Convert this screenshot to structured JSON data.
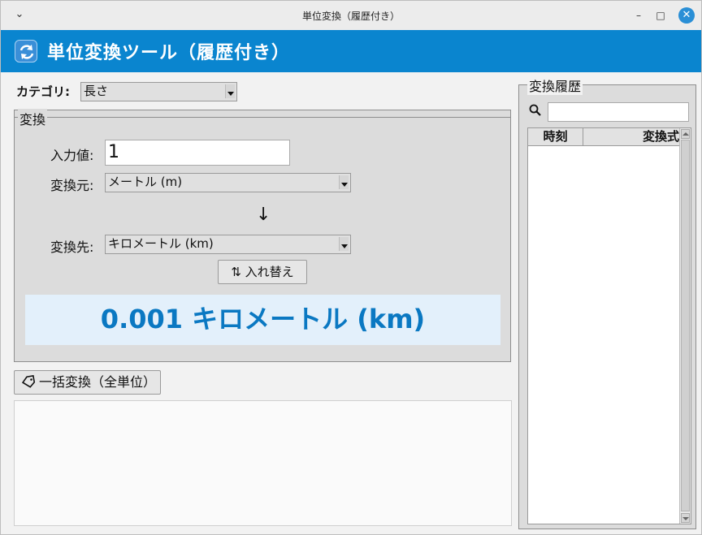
{
  "window": {
    "title": "単位変換（履歴付き）",
    "controls": {
      "menu": "⌄",
      "minimize": "–",
      "maximize": "□",
      "close": "✕"
    }
  },
  "header": {
    "title": "単位変換ツール（履歴付き）",
    "color": "#0a85cf"
  },
  "category": {
    "label": "カテゴリ:",
    "selected": "長さ"
  },
  "conversion": {
    "legend": "変換",
    "input_label": "入力値:",
    "input_value": "1",
    "from_label": "変換元:",
    "from_selected": "メートル (m)",
    "arrow": "↓",
    "to_label": "変換先:",
    "to_selected": "キロメートル (km)",
    "swap_icon": "⇅",
    "swap_label": "入れ替え",
    "result": "0.001 キロメートル (km)",
    "result_color": "#0a78c2"
  },
  "bulk": {
    "icon": "tag-icon",
    "label": "一括変換（全単位）"
  },
  "history": {
    "legend": "変換履歴",
    "search_icon": "search-icon",
    "search_value": "",
    "columns": [
      "時刻",
      "変換式"
    ],
    "rows": []
  }
}
